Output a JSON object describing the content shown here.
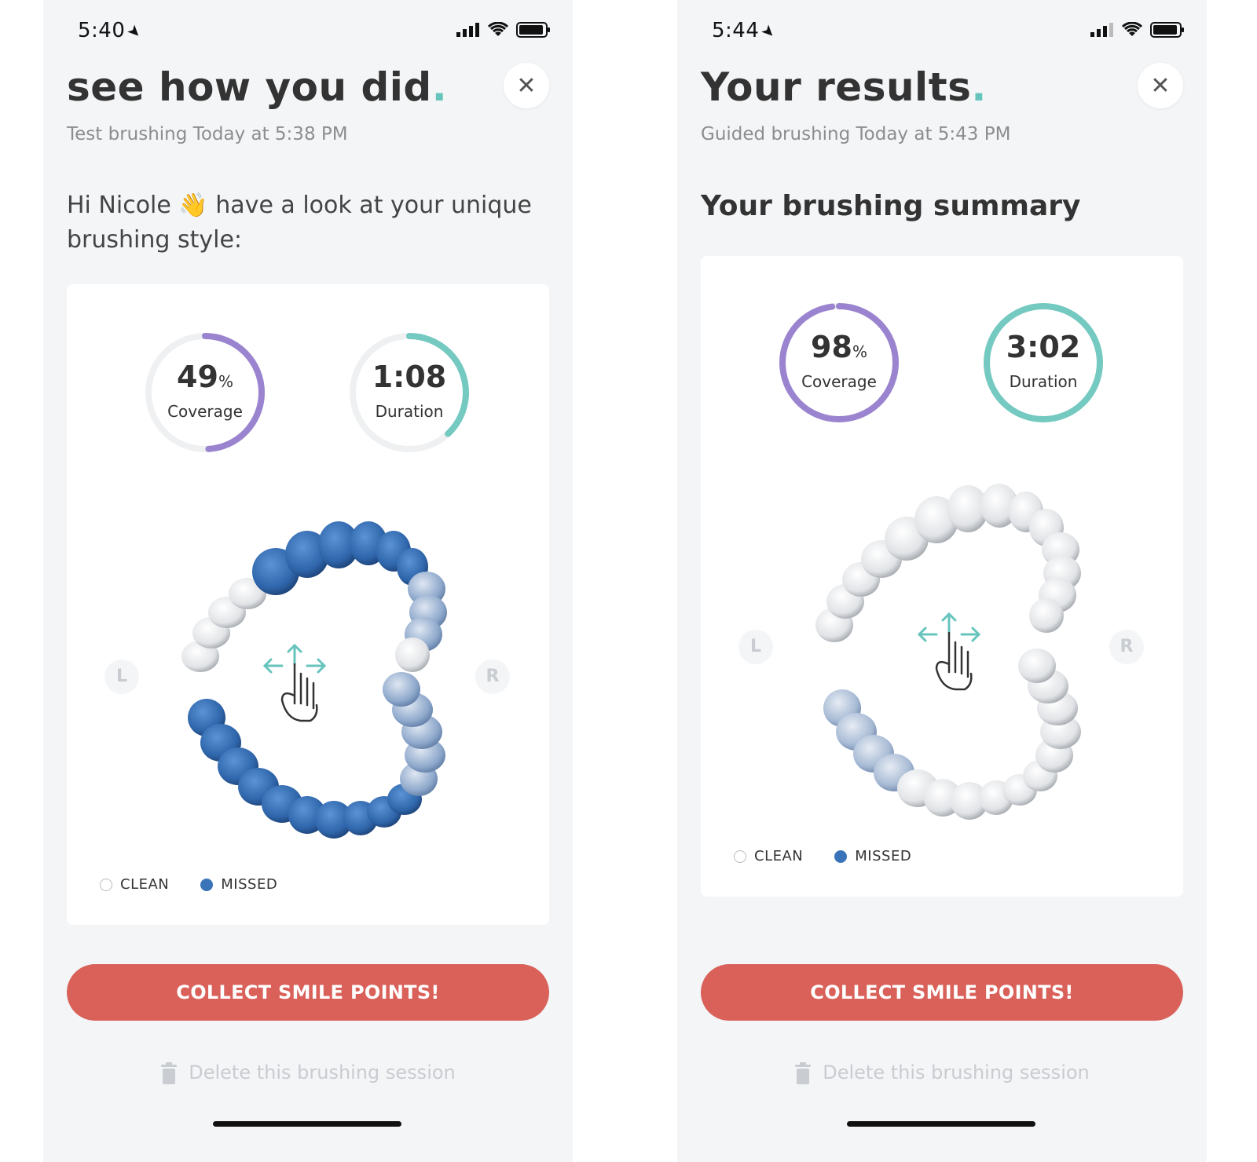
{
  "colors": {
    "accent": "#67c4bd",
    "coverage": "#9b84cf",
    "duration": "#74c9c1",
    "missed": "#3a74b8",
    "cta": "#d9615a"
  },
  "screens": [
    {
      "status_time": "5:40",
      "title": "see how you did",
      "title_dot": ".",
      "close_icon": "✕",
      "subtitle": "Test brushing Today at 5:38 PM",
      "greeting_a": "Hi Nicole ",
      "greeting_emoji": "👋",
      "greeting_b": " have a look at your unique brushing style:",
      "coverage_value": "49",
      "coverage_unit": "%",
      "coverage_label": "Coverage",
      "coverage_fraction": 0.49,
      "duration_value": "1:08",
      "duration_label": "Duration",
      "duration_fraction": 0.38,
      "left_marker": "L",
      "right_marker": "R",
      "legend_clean": "CLEAN",
      "legend_missed": "MISSED",
      "cta_label": "COLLECT SMILE POINTS!",
      "delete_label": "Delete this brushing session"
    },
    {
      "status_time": "5:44",
      "title": "Your results",
      "title_dot": ".",
      "close_icon": "✕",
      "subtitle": "Guided brushing Today at 5:43 PM",
      "section_heading": "Your brushing summary",
      "coverage_value": "98",
      "coverage_unit": "%",
      "coverage_label": "Coverage",
      "coverage_fraction": 0.98,
      "duration_value": "3:02",
      "duration_label": "Duration",
      "duration_fraction": 1.0,
      "left_marker": "L",
      "right_marker": "R",
      "legend_clean": "CLEAN",
      "legend_missed": "MISSED",
      "cta_label": "COLLECT SMILE POINTS!",
      "delete_label": "Delete this brushing session"
    }
  ]
}
